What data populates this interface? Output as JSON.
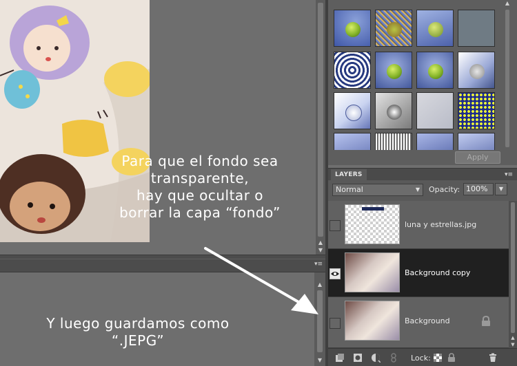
{
  "annotations": {
    "top_note_lines": [
      "Para que el fondo sea",
      "transparente,",
      "hay que ocultar o",
      "borrar la capa “fondo”"
    ],
    "bottom_note_lines": [
      "Y luego guardamos como",
      "“.JEPG”"
    ]
  },
  "effects_panel": {
    "apply_label": "Apply"
  },
  "layers_panel": {
    "title": "LAYERS",
    "blend_mode": "Normal",
    "opacity_label": "Opacity:",
    "opacity_value": "100%",
    "lock_label": "Lock:",
    "layers": [
      {
        "name": "luna y estrellas.jpg",
        "visible": false,
        "selected": false,
        "locked": false
      },
      {
        "name": "Background copy",
        "visible": true,
        "selected": true,
        "locked": false
      },
      {
        "name": "Background",
        "visible": false,
        "selected": false,
        "locked": true
      }
    ]
  },
  "colors": {
    "workspace": "#6f6f6f",
    "selected_layer": "#202020",
    "annotation_text": "#ffffff"
  }
}
